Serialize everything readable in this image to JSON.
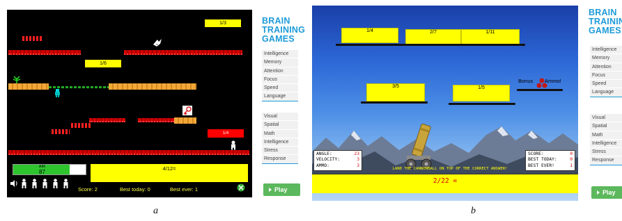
{
  "panel_a": {
    "caption": "a",
    "labels": [
      "1/3",
      "1/6"
    ],
    "door_label": "1/4",
    "air": {
      "label": "AIR",
      "value": "87",
      "level": 0.78
    },
    "question": "4/12=",
    "score_text": "Score: 2",
    "best_today_text": "Best today: 0",
    "best_ever_text": "Best ever: 1",
    "lives": 5,
    "icons": [
      "speaker-icon",
      "player-life-icon",
      "gear-icon",
      "key-icon",
      "plant-icon"
    ],
    "sidebar": {
      "brand_lines": [
        "BRAIN",
        "TRAINING",
        "GAMES"
      ],
      "group1": [
        "Intelligence",
        "Memory",
        "Attention",
        "Focus",
        "Speed",
        "Language"
      ],
      "group2": [
        "Visual",
        "Spatial",
        "Math",
        "Intelligence",
        "Stress",
        "Response"
      ],
      "play_label": "Play"
    }
  },
  "panel_b": {
    "caption": "b",
    "top_boxes": [
      "1/4",
      "2/7",
      "1/11"
    ],
    "mid_boxes": [
      "3/5",
      "1/5"
    ],
    "bonus_text": "Bonus",
    "ammo_text": "Ammo!",
    "stats_left": [
      {
        "label": "ANGLE:",
        "value": "23"
      },
      {
        "label": "VELOCITY:",
        "value": "3"
      },
      {
        "label": "AMMO:",
        "value": "3"
      }
    ],
    "stats_right": [
      {
        "label": "SCORE:",
        "value": "0"
      },
      {
        "label": "BEST TODAY:",
        "value": "0"
      },
      {
        "label": "BEST EVER!",
        "value": "1"
      }
    ],
    "instruction": "LAND THE CANNONBALL ON TOP OF THE CORRECT ANSWER!",
    "question": "2/22 =",
    "icons": [
      "cannon-icon",
      "cannonball-stack-icon"
    ],
    "sidebar": {
      "brand_lines": [
        "BRAIN",
        "TRAINING",
        "GAMES"
      ],
      "group1": [
        "Intelligence",
        "Memory",
        "Attention",
        "Focus",
        "Speed",
        "Language"
      ],
      "group2": [
        "Visual",
        "Spatial",
        "Math",
        "Intelligence",
        "Stress",
        "Response"
      ],
      "play_label": "Play"
    }
  },
  "colors": {
    "brand": "#1d9bd8",
    "play": "#5cb85c",
    "yellow": "#ffff00",
    "girder": "#d20000"
  }
}
